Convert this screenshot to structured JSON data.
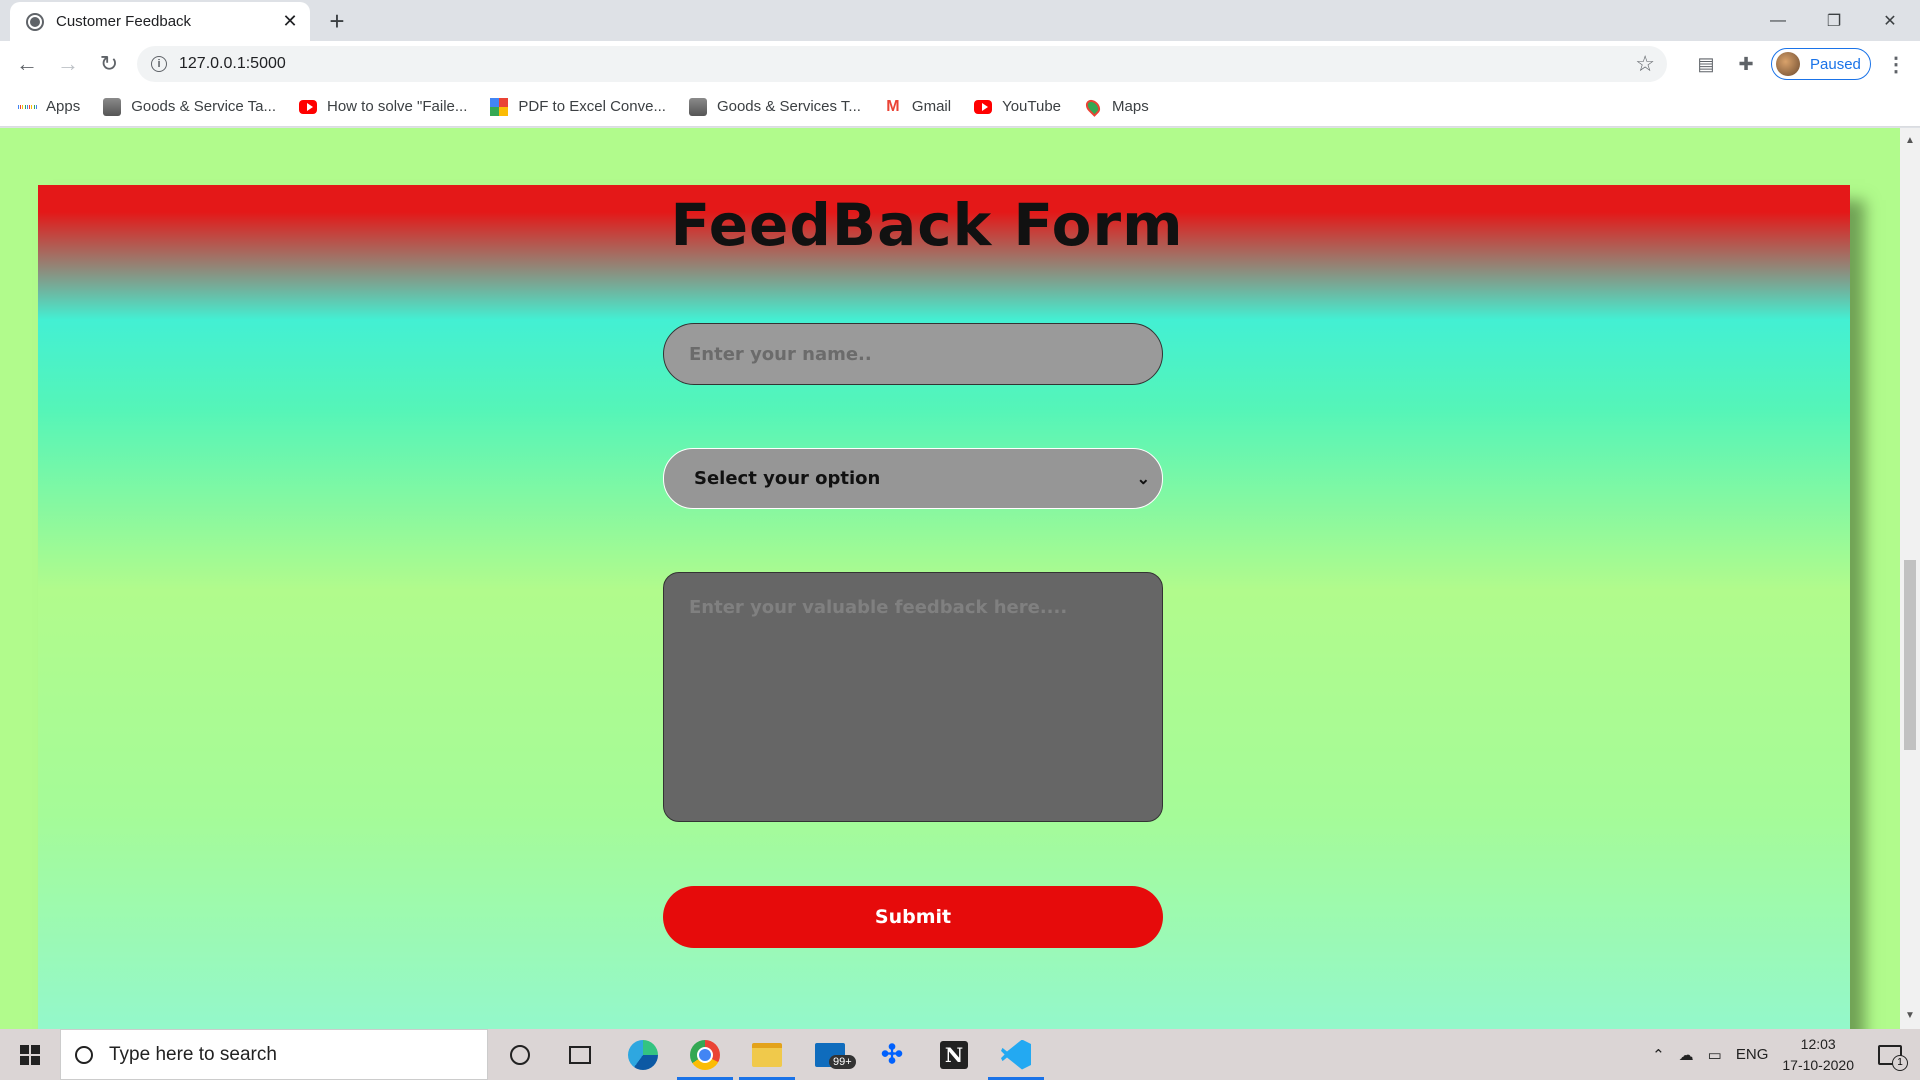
{
  "browser": {
    "tab_title": "Customer Feedback",
    "url": "127.0.0.1:5000",
    "profile_label": "Paused",
    "accent_color": "#1a73e8"
  },
  "bookmarks": [
    {
      "label": "Apps",
      "icon": "apps-grid-icon"
    },
    {
      "label": "Goods & Service Ta...",
      "icon": "gov-emblem-icon"
    },
    {
      "label": "How to solve \"Faile...",
      "icon": "youtube-icon"
    },
    {
      "label": "PDF to Excel Conve...",
      "icon": "pdf-converter-icon"
    },
    {
      "label": "Goods & Services T...",
      "icon": "gov-emblem-icon"
    },
    {
      "label": "Gmail",
      "icon": "gmail-icon"
    },
    {
      "label": "YouTube",
      "icon": "youtube-icon"
    },
    {
      "label": "Maps",
      "icon": "maps-icon"
    }
  ],
  "page": {
    "background_color": "#b1fb8c",
    "title": "FeedBack Form",
    "name_placeholder": "Enter your name..",
    "select_value": "Select your option",
    "feedback_placeholder": "Enter your valuable feedback here....",
    "submit_label": "Submit",
    "submit_color": "#e60b0b"
  },
  "taskbar": {
    "search_placeholder": "Type here to search",
    "mail_badge": "99+",
    "language": "ENG",
    "time": "12:03",
    "date": "17-10-2020",
    "notification_count": "1"
  }
}
